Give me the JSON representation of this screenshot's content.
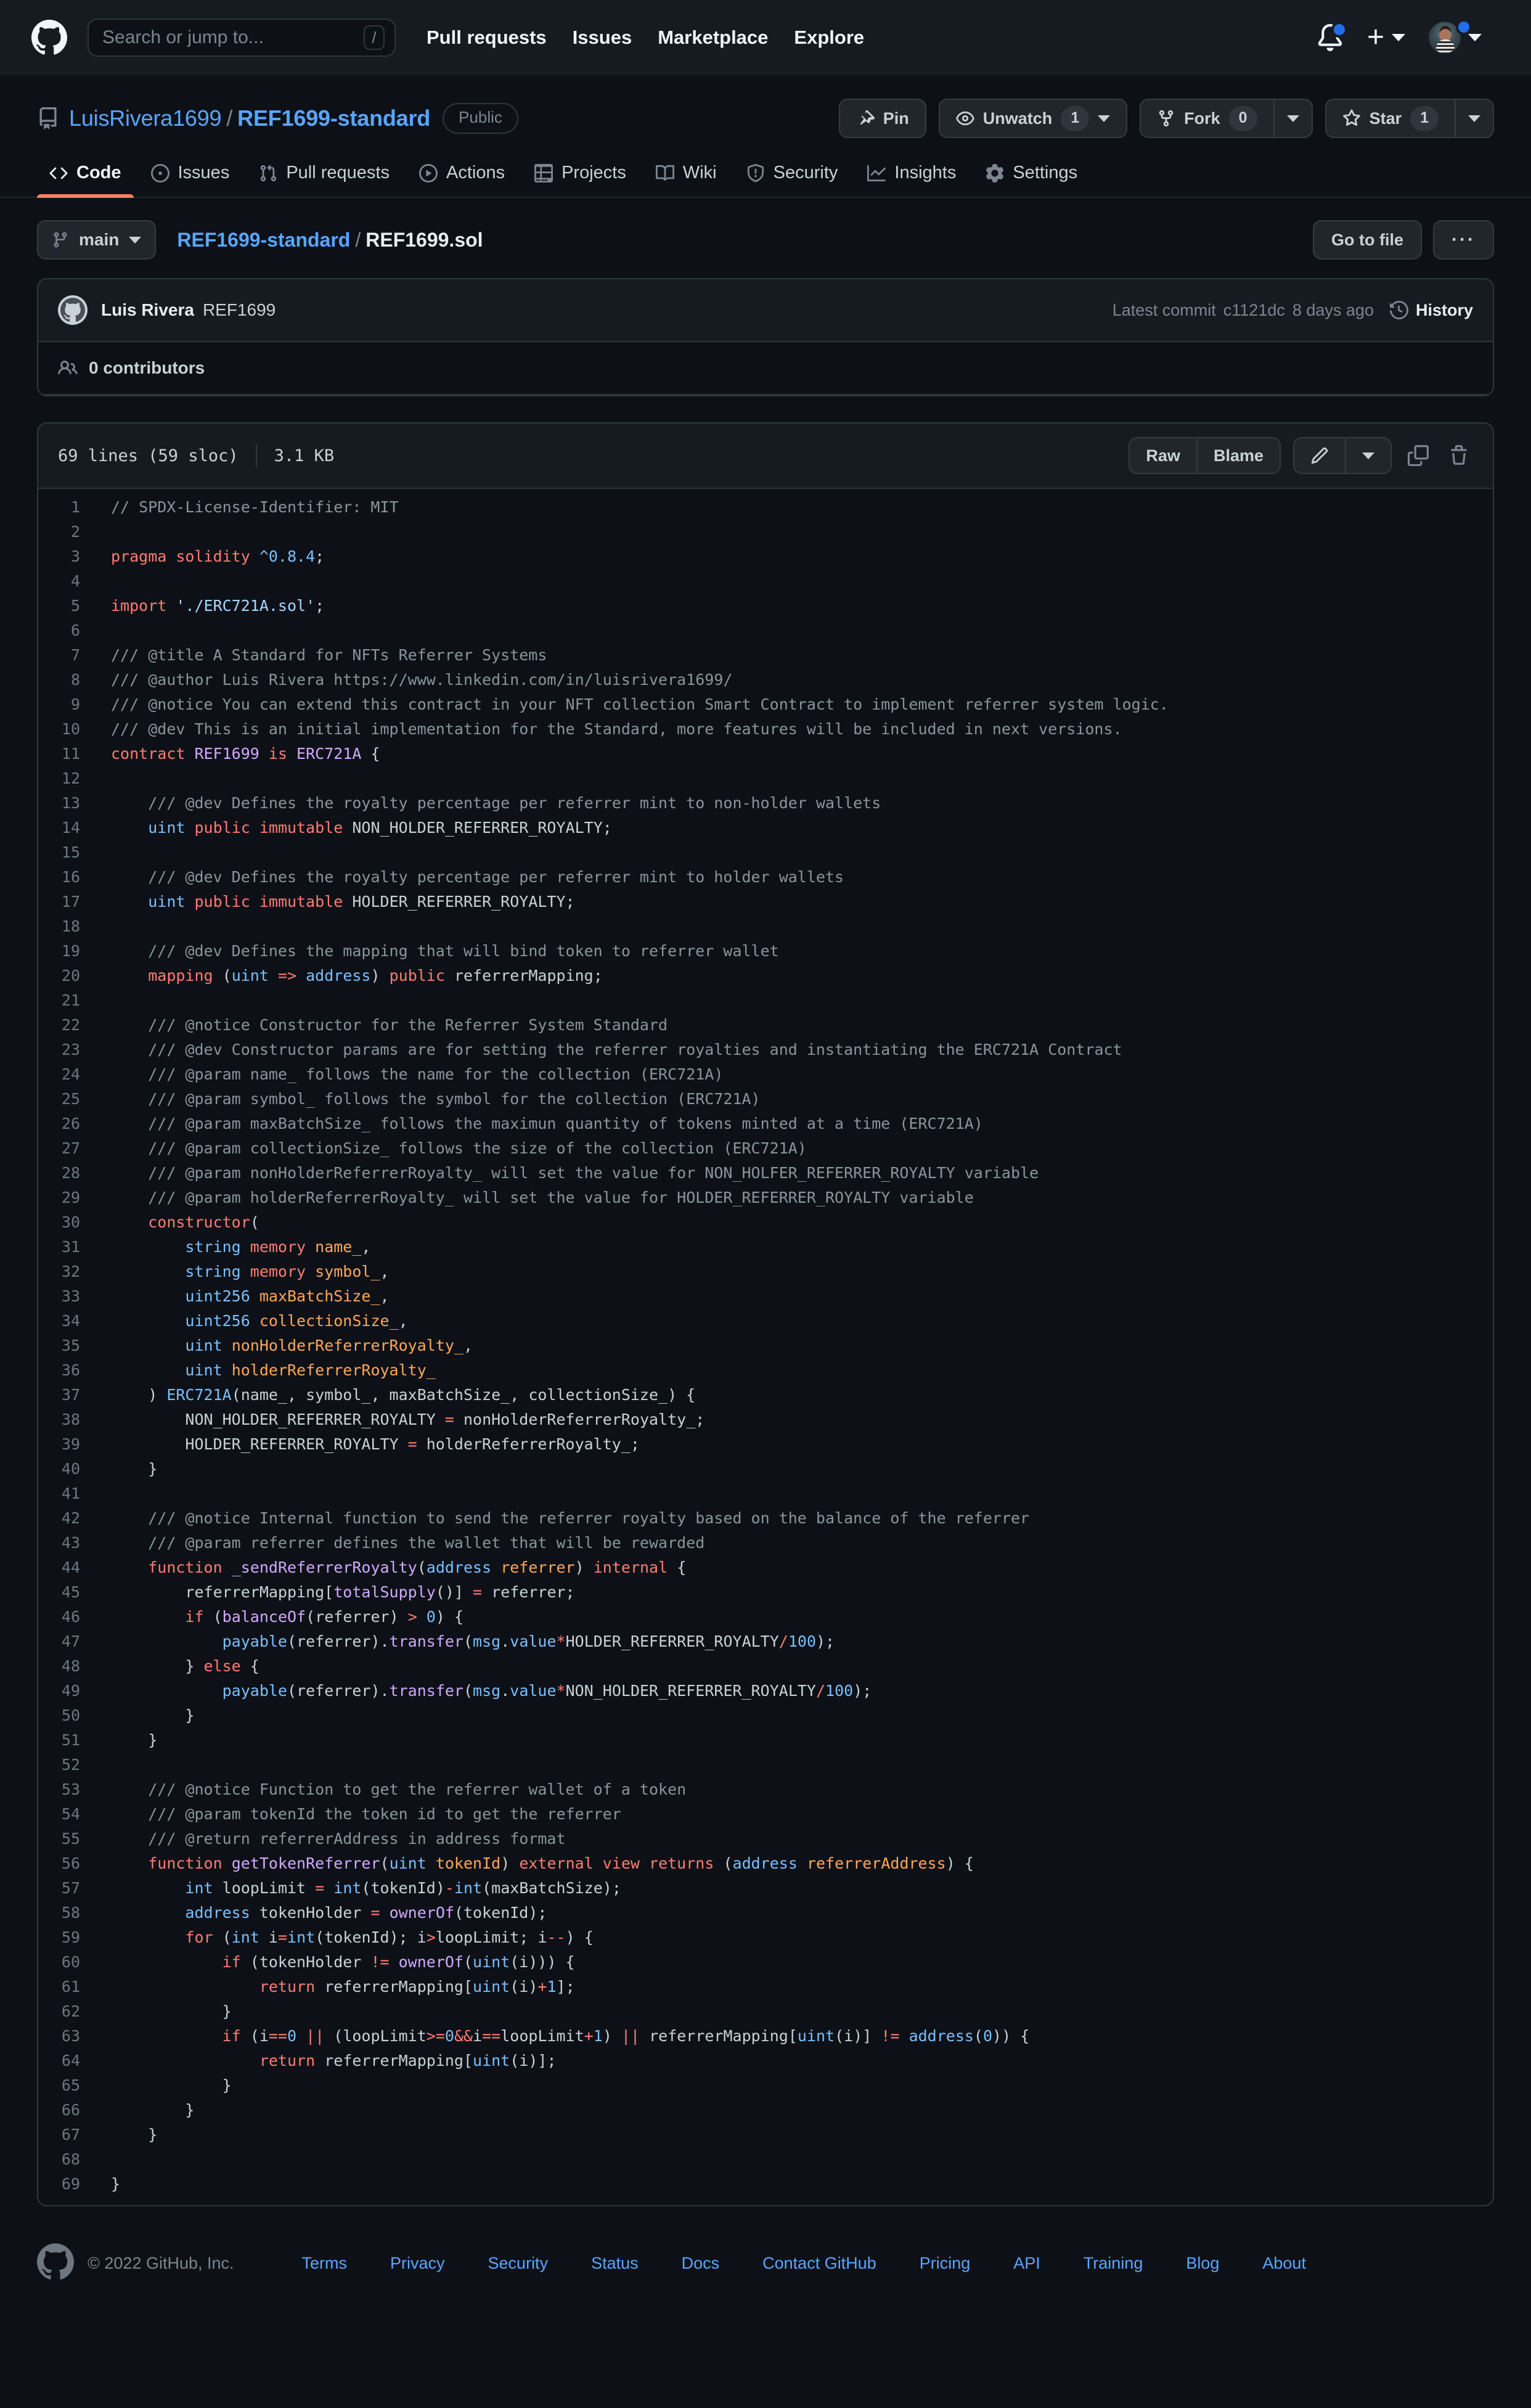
{
  "header": {
    "logo_icon": "github-mark-icon",
    "search": {
      "placeholder": "Search or jump to...",
      "value": "",
      "shortcut": "/"
    },
    "nav": [
      {
        "label": "Pull requests"
      },
      {
        "label": "Issues"
      },
      {
        "label": "Marketplace"
      },
      {
        "label": "Explore"
      }
    ],
    "notifications_icon": "bell-icon",
    "create_new_icon": "plus-icon",
    "profile_icon": "avatar"
  },
  "repo": {
    "icon": "repo-icon",
    "owner": "LuisRivera1699",
    "separator": "/",
    "name": "REF1699-standard",
    "visibility": "Public",
    "actions": {
      "pin": "Pin",
      "watch": "Unwatch",
      "watch_count": "1",
      "fork": "Fork",
      "fork_count": "0",
      "star": "Star",
      "star_count": "1"
    },
    "tabs": [
      {
        "label": "Code",
        "icon": "code-icon",
        "active": true
      },
      {
        "label": "Issues",
        "icon": "issue-opened-icon",
        "active": false
      },
      {
        "label": "Pull requests",
        "icon": "git-pull-request-icon",
        "active": false
      },
      {
        "label": "Actions",
        "icon": "play-icon",
        "active": false
      },
      {
        "label": "Projects",
        "icon": "table-icon",
        "active": false
      },
      {
        "label": "Wiki",
        "icon": "book-icon",
        "active": false
      },
      {
        "label": "Security",
        "icon": "shield-icon",
        "active": false
      },
      {
        "label": "Insights",
        "icon": "graph-icon",
        "active": false
      },
      {
        "label": "Settings",
        "icon": "gear-icon",
        "active": false
      }
    ]
  },
  "file_nav": {
    "branch": "main",
    "branch_icon": "git-branch-icon",
    "breadcrumb_repo": "REF1699-standard",
    "breadcrumb_sep": "/",
    "breadcrumb_file": "REF1699.sol",
    "go_to_file": "Go to file",
    "more": "···"
  },
  "commit": {
    "author": "Luis Rivera",
    "message": "REF1699",
    "latest_label": "Latest commit",
    "sha": "c1121dc",
    "time": "8 days ago",
    "history_label": "History",
    "history_icon": "history-icon",
    "contributors_icon": "people-icon",
    "contributors_text": "0 contributors"
  },
  "file_header": {
    "lines": "69 lines (59 sloc)",
    "size": "3.1 KB",
    "raw": "Raw",
    "blame": "Blame",
    "edit_icon": "pencil-icon",
    "edit_caret_icon": "chevron-down-icon",
    "copy_icon": "copy-icon",
    "delete_icon": "trash-icon"
  },
  "code": {
    "language": "solidity",
    "lines": [
      [
        [
          "c",
          "// SPDX-License-Identifier: MIT"
        ]
      ],
      [],
      [
        [
          "k",
          "pragma solidity "
        ],
        [
          "t",
          "^0.8.4"
        ],
        [
          "p",
          ";"
        ]
      ],
      [],
      [
        [
          "k",
          "import "
        ],
        [
          "s",
          "'./ERC721A.sol'"
        ],
        [
          "p",
          ";"
        ]
      ],
      [],
      [
        [
          "c",
          "/// @title A Standard for NFTs Referrer Systems"
        ]
      ],
      [
        [
          "c",
          "/// @author Luis Rivera https://www.linkedin.com/in/luisrivera1699/"
        ]
      ],
      [
        [
          "c",
          "/// @notice You can extend this contract in your NFT collection Smart Contract to implement referrer system logic."
        ]
      ],
      [
        [
          "c",
          "/// @dev This is an initial implementation for the Standard, more features will be included in next versions."
        ]
      ],
      [
        [
          "k",
          "contract "
        ],
        [
          "f",
          "REF1699 "
        ],
        [
          "k",
          "is "
        ],
        [
          "f",
          "ERC721A"
        ],
        [
          "p",
          " {"
        ]
      ],
      [],
      [
        [
          "p",
          "    "
        ],
        [
          "c",
          "/// @dev Defines the royalty percentage per referrer mint to non-holder wallets"
        ]
      ],
      [
        [
          "p",
          "    "
        ],
        [
          "t",
          "uint "
        ],
        [
          "k",
          "public immutable "
        ],
        [
          "p",
          "NON_HOLDER_REFERRER_ROYALTY;"
        ]
      ],
      [],
      [
        [
          "p",
          "    "
        ],
        [
          "c",
          "/// @dev Defines the royalty percentage per referrer mint to holder wallets"
        ]
      ],
      [
        [
          "p",
          "    "
        ],
        [
          "t",
          "uint "
        ],
        [
          "k",
          "public immutable "
        ],
        [
          "p",
          "HOLDER_REFERRER_ROYALTY;"
        ]
      ],
      [],
      [
        [
          "p",
          "    "
        ],
        [
          "c",
          "/// @dev Defines the mapping that will bind token to referrer wallet"
        ]
      ],
      [
        [
          "p",
          "    "
        ],
        [
          "k",
          "mapping "
        ],
        [
          "p",
          "("
        ],
        [
          "t",
          "uint "
        ],
        [
          "k",
          "=> "
        ],
        [
          "t",
          "address"
        ],
        [
          "p",
          ") "
        ],
        [
          "k",
          "public "
        ],
        [
          "p",
          "referrerMapping;"
        ]
      ],
      [],
      [
        [
          "p",
          "    "
        ],
        [
          "c",
          "/// @notice Constructor for the Referrer System Standard"
        ]
      ],
      [
        [
          "p",
          "    "
        ],
        [
          "c",
          "/// @dev Constructor params are for setting the referrer royalties and instantiating the ERC721A Contract"
        ]
      ],
      [
        [
          "p",
          "    "
        ],
        [
          "c",
          "/// @param name_ follows the name for the collection (ERC721A)"
        ]
      ],
      [
        [
          "p",
          "    "
        ],
        [
          "c",
          "/// @param symbol_ follows the symbol for the collection (ERC721A)"
        ]
      ],
      [
        [
          "p",
          "    "
        ],
        [
          "c",
          "/// @param maxBatchSize_ follows the maximun quantity of tokens minted at a time (ERC721A)"
        ]
      ],
      [
        [
          "p",
          "    "
        ],
        [
          "c",
          "/// @param collectionSize_ follows the size of the collection (ERC721A)"
        ]
      ],
      [
        [
          "p",
          "    "
        ],
        [
          "c",
          "/// @param nonHolderReferrerRoyalty_ will set the value for NON_HOLFER_REFERRER_ROYALTY variable"
        ]
      ],
      [
        [
          "p",
          "    "
        ],
        [
          "c",
          "/// @param holderReferrerRoyalty_ will set the value for HOLDER_REFERRER_ROYALTY variable"
        ]
      ],
      [
        [
          "p",
          "    "
        ],
        [
          "k",
          "constructor"
        ],
        [
          "p",
          "("
        ]
      ],
      [
        [
          "p",
          "        "
        ],
        [
          "t",
          "string "
        ],
        [
          "k",
          "memory "
        ],
        [
          "v",
          "name_"
        ],
        [
          "p",
          ","
        ]
      ],
      [
        [
          "p",
          "        "
        ],
        [
          "t",
          "string "
        ],
        [
          "k",
          "memory "
        ],
        [
          "v",
          "symbol_"
        ],
        [
          "p",
          ","
        ]
      ],
      [
        [
          "p",
          "        "
        ],
        [
          "t",
          "uint256 "
        ],
        [
          "v",
          "maxBatchSize_"
        ],
        [
          "p",
          ","
        ]
      ],
      [
        [
          "p",
          "        "
        ],
        [
          "t",
          "uint256 "
        ],
        [
          "v",
          "collectionSize_"
        ],
        [
          "p",
          ","
        ]
      ],
      [
        [
          "p",
          "        "
        ],
        [
          "t",
          "uint "
        ],
        [
          "v",
          "nonHolderReferrerRoyalty_"
        ],
        [
          "p",
          ","
        ]
      ],
      [
        [
          "p",
          "        "
        ],
        [
          "t",
          "uint "
        ],
        [
          "v",
          "holderReferrerRoyalty_"
        ]
      ],
      [
        [
          "p",
          "    ) "
        ],
        [
          "t",
          "ERC721A"
        ],
        [
          "p",
          "(name_, symbol_, maxBatchSize_, collectionSize_) {"
        ]
      ],
      [
        [
          "p",
          "        NON_HOLDER_REFERRER_ROYALTY "
        ],
        [
          "k",
          "= "
        ],
        [
          "p",
          "nonHolderReferrerRoyalty_;"
        ]
      ],
      [
        [
          "p",
          "        HOLDER_REFERRER_ROYALTY "
        ],
        [
          "k",
          "= "
        ],
        [
          "p",
          "holderReferrerRoyalty_;"
        ]
      ],
      [
        [
          "p",
          "    }"
        ]
      ],
      [],
      [
        [
          "p",
          "    "
        ],
        [
          "c",
          "/// @notice Internal function to send the referrer royalty based on the balance of the referrer"
        ]
      ],
      [
        [
          "p",
          "    "
        ],
        [
          "c",
          "/// @param referrer defines the wallet that will be rewarded"
        ]
      ],
      [
        [
          "p",
          "    "
        ],
        [
          "k",
          "function "
        ],
        [
          "f",
          "_sendReferrerRoyalty"
        ],
        [
          "p",
          "("
        ],
        [
          "t",
          "address "
        ],
        [
          "v",
          "referrer"
        ],
        [
          "p",
          ") "
        ],
        [
          "k",
          "internal "
        ],
        [
          "p",
          "{"
        ]
      ],
      [
        [
          "p",
          "        referrerMapping["
        ],
        [
          "f",
          "totalSupply"
        ],
        [
          "p",
          "()] "
        ],
        [
          "k",
          "= "
        ],
        [
          "p",
          "referrer;"
        ]
      ],
      [
        [
          "p",
          "        "
        ],
        [
          "k",
          "if "
        ],
        [
          "p",
          "("
        ],
        [
          "f",
          "balanceOf"
        ],
        [
          "p",
          "(referrer) "
        ],
        [
          "k",
          "> "
        ],
        [
          "t",
          "0"
        ],
        [
          "p",
          ") {"
        ]
      ],
      [
        [
          "p",
          "            "
        ],
        [
          "t",
          "payable"
        ],
        [
          "p",
          "(referrer)."
        ],
        [
          "f",
          "transfer"
        ],
        [
          "p",
          "("
        ],
        [
          "t",
          "msg"
        ],
        [
          "p",
          "."
        ],
        [
          "t",
          "value"
        ],
        [
          "k",
          "*"
        ],
        [
          "p",
          "HOLDER_REFERRER_ROYALTY"
        ],
        [
          "k",
          "/"
        ],
        [
          "t",
          "100"
        ],
        [
          "p",
          ");"
        ]
      ],
      [
        [
          "p",
          "        } "
        ],
        [
          "k",
          "else "
        ],
        [
          "p",
          "{"
        ]
      ],
      [
        [
          "p",
          "            "
        ],
        [
          "t",
          "payable"
        ],
        [
          "p",
          "(referrer)."
        ],
        [
          "f",
          "transfer"
        ],
        [
          "p",
          "("
        ],
        [
          "t",
          "msg"
        ],
        [
          "p",
          "."
        ],
        [
          "t",
          "value"
        ],
        [
          "k",
          "*"
        ],
        [
          "p",
          "NON_HOLDER_REFERRER_ROYALTY"
        ],
        [
          "k",
          "/"
        ],
        [
          "t",
          "100"
        ],
        [
          "p",
          ");"
        ]
      ],
      [
        [
          "p",
          "        }"
        ]
      ],
      [
        [
          "p",
          "    }"
        ]
      ],
      [],
      [
        [
          "p",
          "    "
        ],
        [
          "c",
          "/// @notice Function to get the referrer wallet of a token"
        ]
      ],
      [
        [
          "p",
          "    "
        ],
        [
          "c",
          "/// @param tokenId the token id to get the referrer"
        ]
      ],
      [
        [
          "p",
          "    "
        ],
        [
          "c",
          "/// @return referrerAddress in address format"
        ]
      ],
      [
        [
          "p",
          "    "
        ],
        [
          "k",
          "function "
        ],
        [
          "f",
          "getTokenReferrer"
        ],
        [
          "p",
          "("
        ],
        [
          "t",
          "uint "
        ],
        [
          "v",
          "tokenId"
        ],
        [
          "p",
          ") "
        ],
        [
          "k",
          "external view returns "
        ],
        [
          "p",
          "("
        ],
        [
          "t",
          "address "
        ],
        [
          "v",
          "referrerAddress"
        ],
        [
          "p",
          ") {"
        ]
      ],
      [
        [
          "p",
          "        "
        ],
        [
          "t",
          "int "
        ],
        [
          "p",
          "loopLimit "
        ],
        [
          "k",
          "= "
        ],
        [
          "t",
          "int"
        ],
        [
          "p",
          "(tokenId)"
        ],
        [
          "k",
          "-"
        ],
        [
          "t",
          "int"
        ],
        [
          "p",
          "(maxBatchSize);"
        ]
      ],
      [
        [
          "p",
          "        "
        ],
        [
          "t",
          "address "
        ],
        [
          "p",
          "tokenHolder "
        ],
        [
          "k",
          "= "
        ],
        [
          "f",
          "ownerOf"
        ],
        [
          "p",
          "(tokenId);"
        ]
      ],
      [
        [
          "p",
          "        "
        ],
        [
          "k",
          "for "
        ],
        [
          "p",
          "("
        ],
        [
          "t",
          "int "
        ],
        [
          "p",
          "i"
        ],
        [
          "k",
          "="
        ],
        [
          "t",
          "int"
        ],
        [
          "p",
          "(tokenId); i"
        ],
        [
          "k",
          ">"
        ],
        [
          "p",
          "loopLimit; i"
        ],
        [
          "k",
          "--"
        ],
        [
          "p",
          ") {"
        ]
      ],
      [
        [
          "p",
          "            "
        ],
        [
          "k",
          "if "
        ],
        [
          "p",
          "(tokenHolder "
        ],
        [
          "k",
          "!= "
        ],
        [
          "f",
          "ownerOf"
        ],
        [
          "p",
          "("
        ],
        [
          "t",
          "uint"
        ],
        [
          "p",
          "(i))) {"
        ]
      ],
      [
        [
          "p",
          "                "
        ],
        [
          "k",
          "return "
        ],
        [
          "p",
          "referrerMapping["
        ],
        [
          "t",
          "uint"
        ],
        [
          "p",
          "(i)"
        ],
        [
          "k",
          "+"
        ],
        [
          "t",
          "1"
        ],
        [
          "p",
          "];"
        ]
      ],
      [
        [
          "p",
          "            }"
        ]
      ],
      [
        [
          "p",
          "            "
        ],
        [
          "k",
          "if "
        ],
        [
          "p",
          "(i"
        ],
        [
          "k",
          "=="
        ],
        [
          "t",
          "0 "
        ],
        [
          "k",
          "|| "
        ],
        [
          "p",
          "(loopLimit"
        ],
        [
          "k",
          ">="
        ],
        [
          "t",
          "0"
        ],
        [
          "k",
          "&&"
        ],
        [
          "p",
          "i"
        ],
        [
          "k",
          "=="
        ],
        [
          "p",
          "loopLimit"
        ],
        [
          "k",
          "+"
        ],
        [
          "t",
          "1"
        ],
        [
          "p",
          ") "
        ],
        [
          "k",
          "|| "
        ],
        [
          "p",
          "referrerMapping["
        ],
        [
          "t",
          "uint"
        ],
        [
          "p",
          "(i)] "
        ],
        [
          "k",
          "!= "
        ],
        [
          "t",
          "address"
        ],
        [
          "p",
          "("
        ],
        [
          "t",
          "0"
        ],
        [
          "p",
          ")) {"
        ]
      ],
      [
        [
          "p",
          "                "
        ],
        [
          "k",
          "return "
        ],
        [
          "p",
          "referrerMapping["
        ],
        [
          "t",
          "uint"
        ],
        [
          "p",
          "(i)];"
        ]
      ],
      [
        [
          "p",
          "            }"
        ]
      ],
      [
        [
          "p",
          "        }"
        ]
      ],
      [
        [
          "p",
          "    }"
        ]
      ],
      [],
      [
        [
          "p",
          "}"
        ]
      ]
    ]
  },
  "footer": {
    "logo_icon": "github-mark-icon",
    "copyright": "© 2022 GitHub, Inc.",
    "links": [
      "Terms",
      "Privacy",
      "Security",
      "Status",
      "Docs",
      "Contact GitHub",
      "Pricing",
      "API",
      "Training",
      "Blog",
      "About"
    ]
  },
  "colors": {
    "page_bg": "#0d1117",
    "surface": "#161b22",
    "border": "#30363d",
    "link": "#58a6ff",
    "accent_active_tab": "#f78166",
    "notification_dot": "#1f6feb"
  }
}
